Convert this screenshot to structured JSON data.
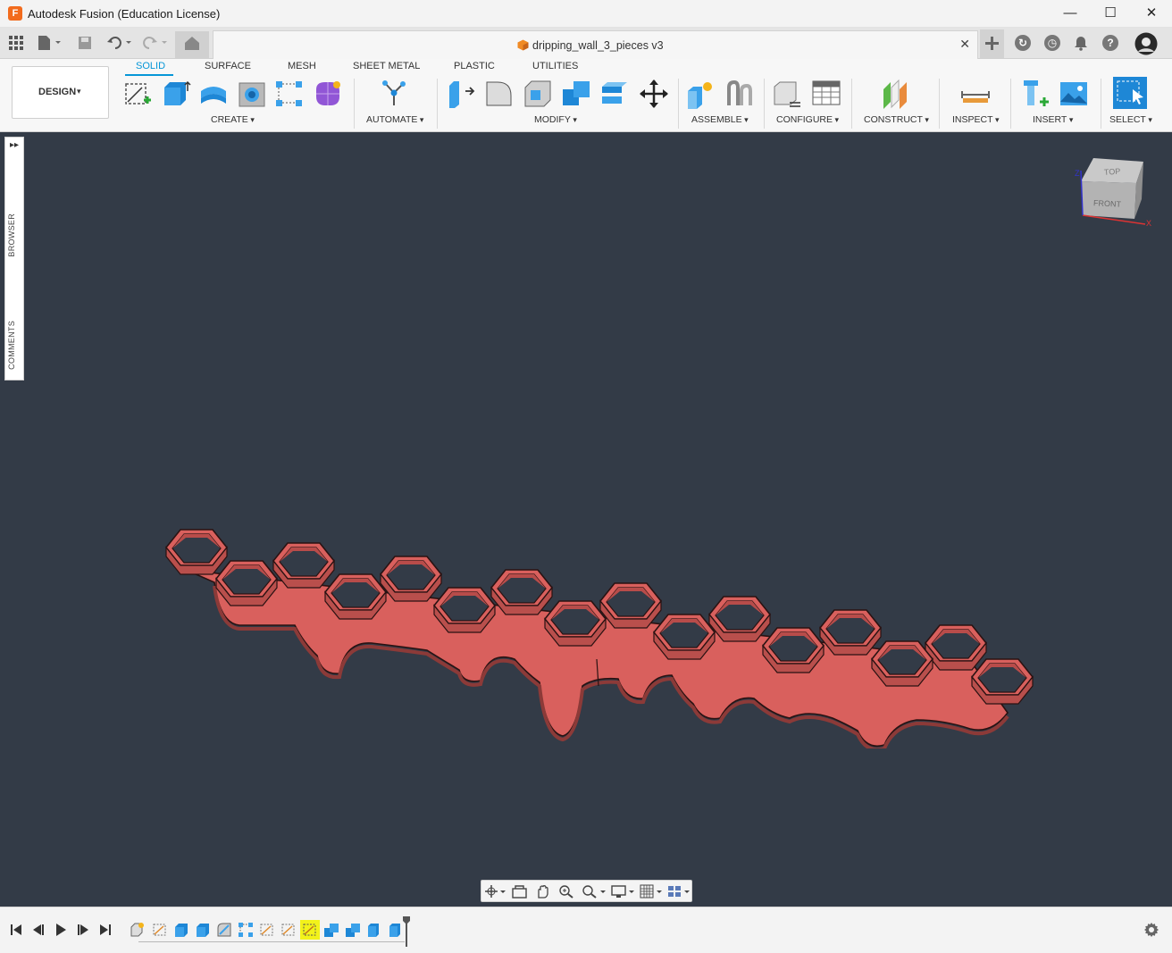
{
  "window": {
    "title": "Autodesk Fusion (Education License)",
    "logo_letter": "F",
    "minimize": "—",
    "maximize": "☐",
    "close": "✕"
  },
  "document_tab": {
    "title": "dripping_wall_3_pieces v3",
    "close": "✕"
  },
  "quick_access": {
    "icons": [
      "apps-grid-icon",
      "file-icon",
      "save-icon",
      "undo-icon",
      "redo-icon",
      "home-icon"
    ],
    "right_icons": [
      "new-tab-icon",
      "job-status-icon",
      "history-icon",
      "notifications-icon",
      "help-icon",
      "user-avatar"
    ]
  },
  "ribbon": {
    "workspace": "DESIGN",
    "tabs": [
      {
        "label": "SOLID",
        "active": true
      },
      {
        "label": "SURFACE",
        "active": false
      },
      {
        "label": "MESH",
        "active": false
      },
      {
        "label": "SHEET METAL",
        "active": false
      },
      {
        "label": "PLASTIC",
        "active": false
      },
      {
        "label": "UTILITIES",
        "active": false
      }
    ],
    "groups": {
      "create": "CREATE",
      "automate": "AUTOMATE",
      "modify": "MODIFY",
      "assemble": "ASSEMBLE",
      "configure": "CONFIGURE",
      "construct": "CONSTRUCT",
      "inspect": "INSPECT",
      "insert": "INSERT",
      "select": "SELECT"
    }
  },
  "side_panel": {
    "expand": "▸▸",
    "browser": "BROWSER",
    "comments": "COMMENTS"
  },
  "viewcube": {
    "top": "TOP",
    "front": "FRONT",
    "axis_x": "X",
    "axis_z": "Z"
  },
  "colors": {
    "viewport_bg": "#333b47",
    "model_fill": "#d9605d",
    "accent": "#0696d7"
  }
}
